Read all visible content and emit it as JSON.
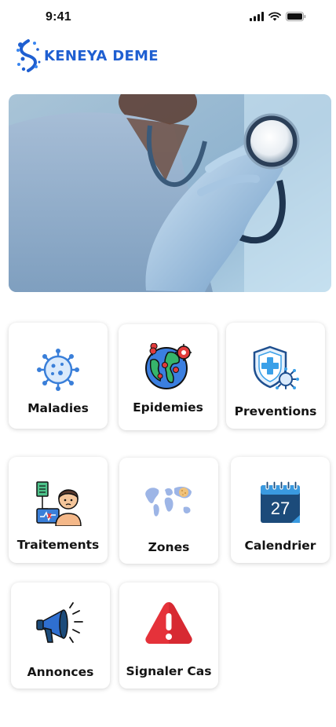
{
  "status_bar": {
    "time": "9:41"
  },
  "brand": {
    "name": "KENEYA DEME",
    "color": "#1f5fd1"
  },
  "menu": [
    {
      "id": "maladies",
      "label": "Maladies",
      "icon": "virus-icon"
    },
    {
      "id": "epidemies",
      "label": "Epidemies",
      "icon": "globe-pins-icon"
    },
    {
      "id": "preventions",
      "label": "Preventions",
      "icon": "shield-virus-icon"
    },
    {
      "id": "traitements",
      "label": "Traitements",
      "icon": "patient-monitor-icon"
    },
    {
      "id": "zones",
      "label": "Zones",
      "icon": "world-map-icon"
    },
    {
      "id": "calendrier",
      "label": "Calendrier",
      "icon": "calendar-icon",
      "calendar_day": "27"
    },
    {
      "id": "annonces",
      "label": "Annonces",
      "icon": "megaphone-icon"
    },
    {
      "id": "signaler",
      "label": "Signaler Cas",
      "icon": "warning-icon"
    }
  ]
}
